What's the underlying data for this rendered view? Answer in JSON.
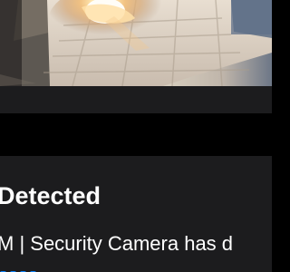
{
  "alert": {
    "title": "Detected",
    "body": "M | Security Camera has d"
  },
  "media": {
    "type": "security-camera-frame",
    "scene": "bright flare over a tiled floor"
  },
  "colors": {
    "background": "#000000",
    "card": "#1c1c1e",
    "text": "#ffffff",
    "link": "#0a84ff"
  }
}
